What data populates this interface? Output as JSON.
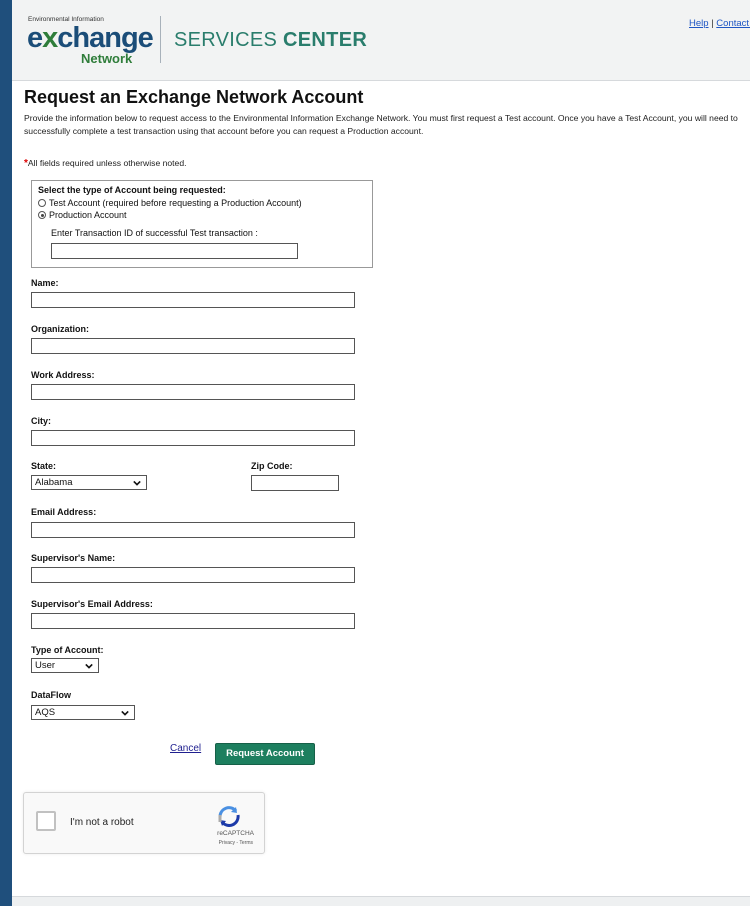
{
  "header": {
    "logo_top": "Environmental Information",
    "logo_main_e": "e",
    "logo_main_x": "x",
    "logo_main_rest": "change",
    "logo_sub": "Network",
    "services_light": "SERVICES ",
    "services_bold": "CENTER",
    "help_link": "Help",
    "separator": "|",
    "contact_link": "Contact U"
  },
  "page": {
    "title": "Request an Exchange Network Account",
    "intro": "Provide the information below to request access to the Environmental Information Exchange Network. You must first request a Test account. Once you have a Test Account, you will need to successfully complete a test transaction using that account before you can request a Production account.",
    "required_star": "*",
    "required_note": "All fields required unless otherwise noted."
  },
  "account_type": {
    "legend": "Select the type of Account being requested:",
    "options": [
      {
        "label": "Test Account (required before requesting a Production Account)",
        "checked": false
      },
      {
        "label": "Production Account",
        "checked": true
      }
    ],
    "txid_label": "Enter Transaction ID of successful Test transaction :",
    "txid_value": ""
  },
  "form": {
    "name_label": "Name:",
    "organization_label": "Organization:",
    "work_address_label": "Work Address:",
    "city_label": "City:",
    "state_label": "State:",
    "state_value": "Alabama",
    "zip_label": "Zip Code:",
    "email_label": "Email Address:",
    "supervisor_name_label": "Supervisor's Name:",
    "supervisor_email_label": "Supervisor's Email Address:",
    "type_label": "Type of Account:",
    "type_value": "User",
    "dataflow_label": "DataFlow",
    "dataflow_value": "AQS",
    "cancel_label": "Cancel",
    "submit_label": "Request Account"
  },
  "recaptcha": {
    "label": "I'm not a robot",
    "brand": "reCAPTCHA",
    "terms": "Privacy - Terms"
  },
  "colors": {
    "background": "#1f4f7c",
    "header_bg": "#f2f3f3",
    "brand_green": "#2f7d3a",
    "brand_blue": "#1b4d78",
    "button_green": "#1d7f5f",
    "link_blue": "#1f56c4"
  }
}
